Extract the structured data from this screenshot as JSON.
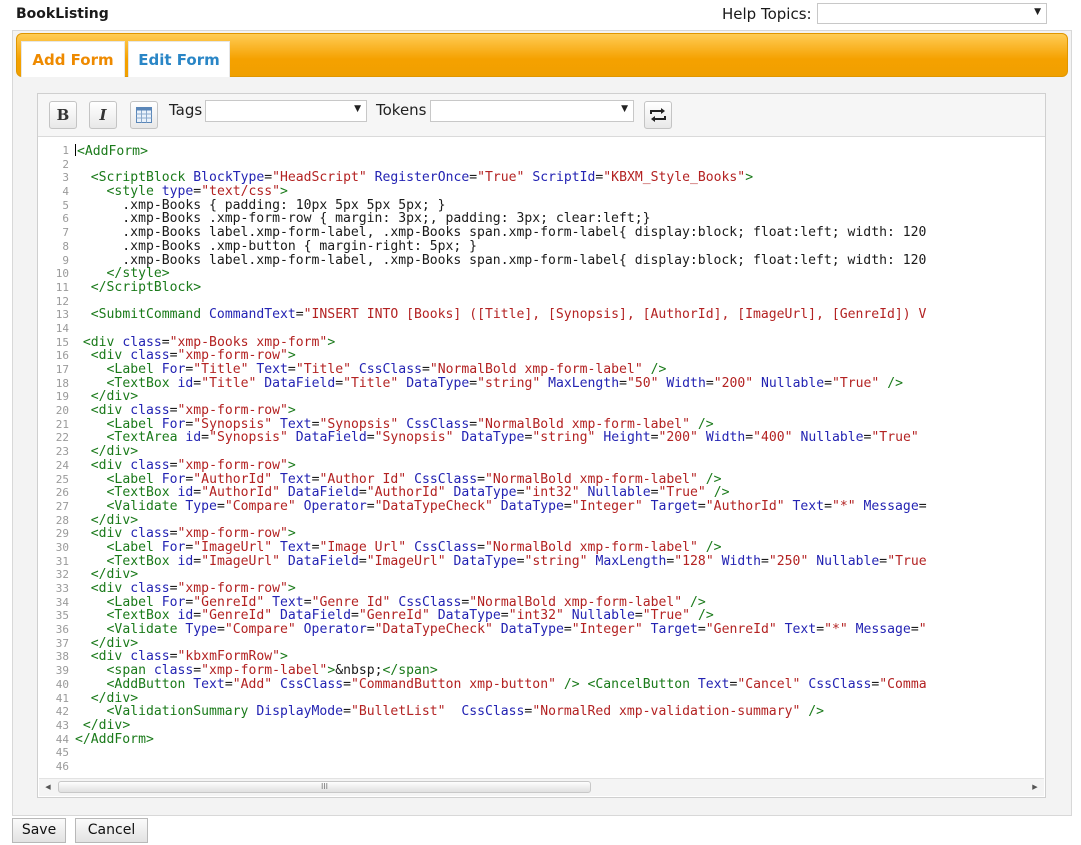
{
  "header": {
    "title": "BookListing",
    "help_topics_label": "Help Topics:",
    "help_topics_value": ""
  },
  "tabs": [
    {
      "label": "Add Form"
    },
    {
      "label": "Edit Form"
    }
  ],
  "toolbar": {
    "bold_label": "B",
    "italic_label": "I",
    "tags_label": "Tags",
    "tags_value": "",
    "tokens_label": "Tokens",
    "tokens_value": ""
  },
  "editor": {
    "line_numbers": [
      "1",
      "2",
      "3",
      "4",
      "5",
      "6",
      "7",
      "8",
      "9",
      "10",
      "11",
      "12",
      "13",
      "14",
      "15",
      "16",
      "17",
      "18",
      "19",
      "20",
      "21",
      "22",
      "23",
      "24",
      "25",
      "26",
      "27",
      "28",
      "29",
      "30",
      "31",
      "32",
      "33",
      "34",
      "35",
      "36",
      "37",
      "38",
      "39",
      "40",
      "41",
      "42",
      "43",
      "44",
      "45",
      "46"
    ],
    "lines": [
      "<AddForm>",
      "",
      "  <ScriptBlock BlockType=\"HeadScript\" RegisterOnce=\"True\" ScriptId=\"KBXM_Style_Books\">",
      "    <style type=\"text/css\">",
      "      .xmp-Books { padding: 10px 5px 5px 5px; }",
      "      .xmp-Books .xmp-form-row { margin: 3px;, padding: 3px; clear:left;}",
      "      .xmp-Books label.xmp-form-label, .xmp-Books span.xmp-form-label{ display:block; float:left; width: 120",
      "      .xmp-Books .xmp-button { margin-right: 5px; }",
      "      .xmp-Books label.xmp-form-label, .xmp-Books span.xmp-form-label{ display:block; float:left; width: 120",
      "    </style>",
      "  </ScriptBlock>",
      "",
      "  <SubmitCommand CommandText=\"INSERT INTO [Books] ([Title], [Synopsis], [AuthorId], [ImageUrl], [GenreId]) V",
      "",
      " <div class=\"xmp-Books xmp-form\">",
      "  <div class=\"xmp-form-row\">",
      "    <Label For=\"Title\" Text=\"Title\" CssClass=\"NormalBold xmp-form-label\" />",
      "    <TextBox id=\"Title\" DataField=\"Title\" DataType=\"string\" MaxLength=\"50\" Width=\"200\" Nullable=\"True\" />",
      "  </div>",
      "  <div class=\"xmp-form-row\">",
      "    <Label For=\"Synopsis\" Text=\"Synopsis\" CssClass=\"NormalBold xmp-form-label\" />",
      "    <TextArea id=\"Synopsis\" DataField=\"Synopsis\" DataType=\"string\" Height=\"200\" Width=\"400\" Nullable=\"True\"",
      "  </div>",
      "  <div class=\"xmp-form-row\">",
      "    <Label For=\"AuthorId\" Text=\"Author Id\" CssClass=\"NormalBold xmp-form-label\" />",
      "    <TextBox id=\"AuthorId\" DataField=\"AuthorId\" DataType=\"int32\" Nullable=\"True\" />",
      "    <Validate Type=\"Compare\" Operator=\"DataTypeCheck\" DataType=\"Integer\" Target=\"AuthorId\" Text=\"*\" Message=",
      "  </div>",
      "  <div class=\"xmp-form-row\">",
      "    <Label For=\"ImageUrl\" Text=\"Image Url\" CssClass=\"NormalBold xmp-form-label\" />",
      "    <TextBox id=\"ImageUrl\" DataField=\"ImageUrl\" DataType=\"string\" MaxLength=\"128\" Width=\"250\" Nullable=\"True",
      "  </div>",
      "  <div class=\"xmp-form-row\">",
      "    <Label For=\"GenreId\" Text=\"Genre Id\" CssClass=\"NormalBold xmp-form-label\" />",
      "    <TextBox id=\"GenreId\" DataField=\"GenreId\" DataType=\"int32\" Nullable=\"True\" />",
      "    <Validate Type=\"Compare\" Operator=\"DataTypeCheck\" DataType=\"Integer\" Target=\"GenreId\" Text=\"*\" Message=\"",
      "  </div>",
      "  <div class=\"kbxmFormRow\">",
      "    <span class=\"xmp-form-label\">&nbsp;</span>",
      "    <AddButton Text=\"Add\" CssClass=\"CommandButton xmp-button\" /> <CancelButton Text=\"Cancel\" CssClass=\"Comma",
      "  </div>",
      "    <ValidationSummary DisplayMode=\"BulletList\"  CssClass=\"NormalRed xmp-validation-summary\" />",
      " </div>",
      "</AddForm>",
      "",
      ""
    ]
  },
  "scrollbar": {
    "thumb_glyph": "III"
  },
  "footer": {
    "save_label": "Save",
    "cancel_label": "Cancel"
  },
  "colors": {
    "tab_bar": "#f5a100",
    "active_tab_text": "#ee8a00",
    "inactive_tab_text": "#2a86c6",
    "tag": "#1a7a1a",
    "attribute": "#2323b3",
    "value": "#b32222"
  },
  "icons": {
    "table": "table-icon",
    "swap": "swap-icon",
    "dropdown": "chevron-down-icon"
  }
}
